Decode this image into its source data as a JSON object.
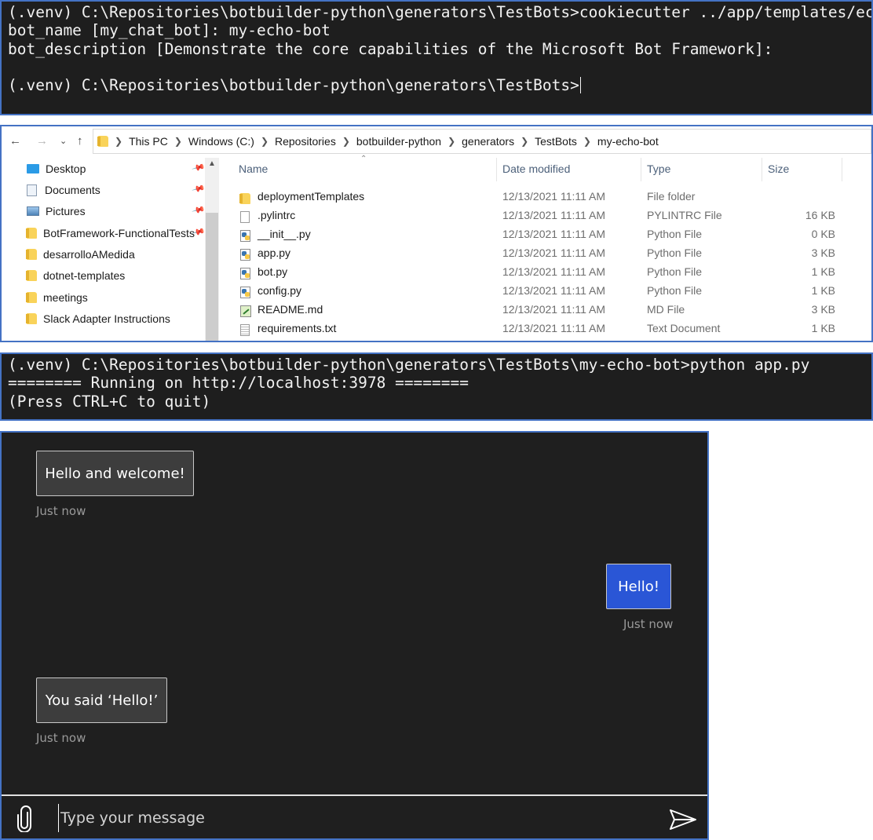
{
  "terminal1": {
    "lines": [
      "(.venv) C:\\Repositories\\botbuilder-python\\generators\\TestBots>cookiecutter ../app/templates/echo",
      "bot_name [my_chat_bot]: my-echo-bot",
      "bot_description [Demonstrate the core capabilities of the Microsoft Bot Framework]:",
      "",
      "(.venv) C:\\Repositories\\botbuilder-python\\generators\\TestBots>"
    ]
  },
  "explorer": {
    "breadcrumb": [
      "This PC",
      "Windows (C:)",
      "Repositories",
      "botbuilder-python",
      "generators",
      "TestBots",
      "my-echo-bot"
    ],
    "quick_access": [
      {
        "label": "Desktop",
        "icon": "desktop-icon",
        "pinned": true
      },
      {
        "label": "Documents",
        "icon": "documents-icon",
        "pinned": true
      },
      {
        "label": "Pictures",
        "icon": "pictures-icon",
        "pinned": true
      },
      {
        "label": "BotFramework-FunctionalTests",
        "icon": "folder-icon",
        "pinned": true
      },
      {
        "label": "desarrolloAMedida",
        "icon": "folder-icon",
        "pinned": false
      },
      {
        "label": "dotnet-templates",
        "icon": "folder-icon",
        "pinned": false
      },
      {
        "label": "meetings",
        "icon": "folder-icon",
        "pinned": false
      },
      {
        "label": "Slack Adapter Instructions",
        "icon": "folder-icon",
        "pinned": false
      }
    ],
    "columns": {
      "name": "Name",
      "date": "Date modified",
      "type": "Type",
      "size": "Size"
    },
    "files": [
      {
        "name": "deploymentTemplates",
        "date": "12/13/2021 11:11 AM",
        "type": "File folder",
        "size": "",
        "icon": "folder-icon"
      },
      {
        "name": ".pylintrc",
        "date": "12/13/2021 11:11 AM",
        "type": "PYLINTRC File",
        "size": "16 KB",
        "icon": "file-icon"
      },
      {
        "name": "__init__.py",
        "date": "12/13/2021 11:11 AM",
        "type": "Python File",
        "size": "0 KB",
        "icon": "python-file-icon"
      },
      {
        "name": "app.py",
        "date": "12/13/2021 11:11 AM",
        "type": "Python File",
        "size": "3 KB",
        "icon": "python-file-icon"
      },
      {
        "name": "bot.py",
        "date": "12/13/2021 11:11 AM",
        "type": "Python File",
        "size": "1 KB",
        "icon": "python-file-icon"
      },
      {
        "name": "config.py",
        "date": "12/13/2021 11:11 AM",
        "type": "Python File",
        "size": "1 KB",
        "icon": "python-file-icon"
      },
      {
        "name": "README.md",
        "date": "12/13/2021 11:11 AM",
        "type": "MD File",
        "size": "3 KB",
        "icon": "markdown-file-icon"
      },
      {
        "name": "requirements.txt",
        "date": "12/13/2021 11:11 AM",
        "type": "Text Document",
        "size": "1 KB",
        "icon": "text-file-icon"
      }
    ]
  },
  "terminal2": {
    "lines": [
      "(.venv) C:\\Repositories\\botbuilder-python\\generators\\TestBots\\my-echo-bot>python app.py",
      "======== Running on http://localhost:3978 ========",
      "(Press CTRL+C to quit)"
    ]
  },
  "chat": {
    "messages": [
      {
        "from": "bot",
        "text": "Hello and welcome!",
        "timestamp": "Just now"
      },
      {
        "from": "user",
        "text": "Hello!",
        "timestamp": "Just now"
      },
      {
        "from": "bot",
        "text": "You said ‘Hello!’",
        "timestamp": "Just now"
      }
    ],
    "input_placeholder": "Type your message",
    "input_value": ""
  },
  "colors": {
    "terminal_bg": "#1e1e1e",
    "panel_border": "#4472c4",
    "chat_bg": "#1f1f1f",
    "user_bubble": "#2a56d6",
    "bot_bubble": "#3d3d3d"
  }
}
